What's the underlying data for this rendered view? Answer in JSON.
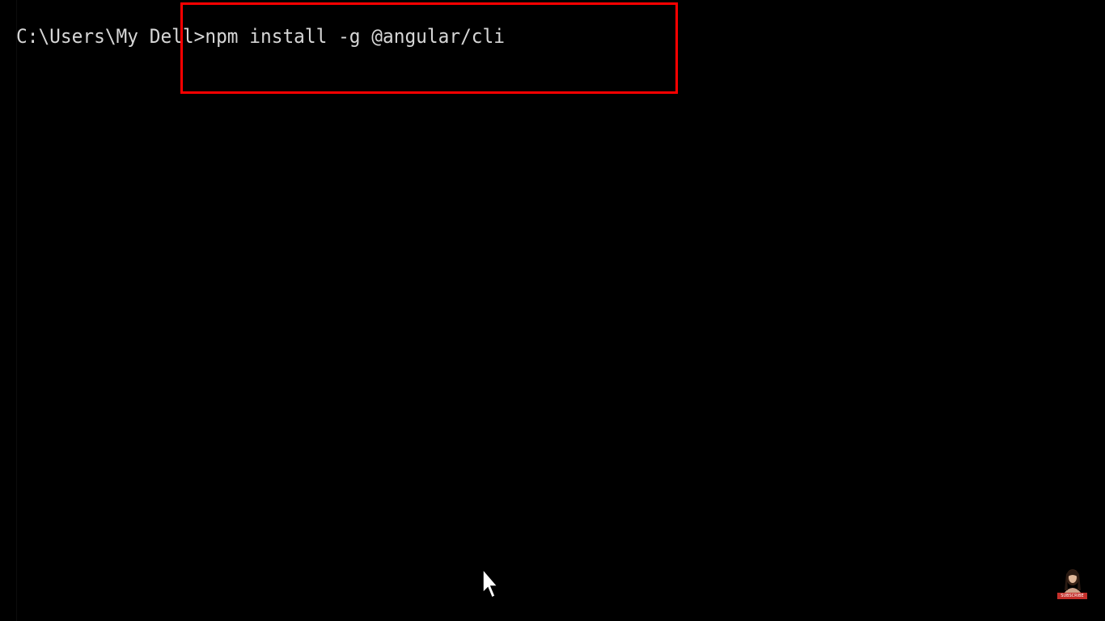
{
  "terminal": {
    "prompt": "C:\\Users\\My Dell>",
    "command": "npm install -g @angular/cli"
  },
  "overlay": {
    "subscribe_label": "SUBSCRIBE"
  },
  "colors": {
    "background": "#000000",
    "text": "#d6d6d6",
    "highlight": "#ff0000"
  },
  "icons": {
    "cursor": "mouse-pointer-icon",
    "avatar": "channel-avatar-icon"
  }
}
